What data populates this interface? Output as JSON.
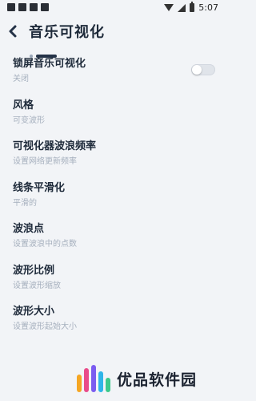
{
  "status_bar": {
    "time": "5:07"
  },
  "header": {
    "title": "音乐可视化"
  },
  "settings": [
    {
      "title": "锁屏音乐可视化",
      "subtitle": "关闭",
      "toggle_on": false
    },
    {
      "title": "风格",
      "subtitle": "可变波形"
    },
    {
      "title": "可视化器波浪频率",
      "subtitle": "设置网络更新频率"
    },
    {
      "title": "线条平滑化",
      "subtitle": "平滑的"
    },
    {
      "title": "波浪点",
      "subtitle": "设置波浪中的点数"
    },
    {
      "title": "波形比例",
      "subtitle": "设置波形缩放"
    },
    {
      "title": "波形大小",
      "subtitle": "设置波形起始大小"
    }
  ],
  "watermark": {
    "text": "优品软件园"
  },
  "colors": {
    "background": "#f2f4f7",
    "title": "#1e2a3a",
    "subtitle": "#a6b0be",
    "accent": "#243247"
  }
}
